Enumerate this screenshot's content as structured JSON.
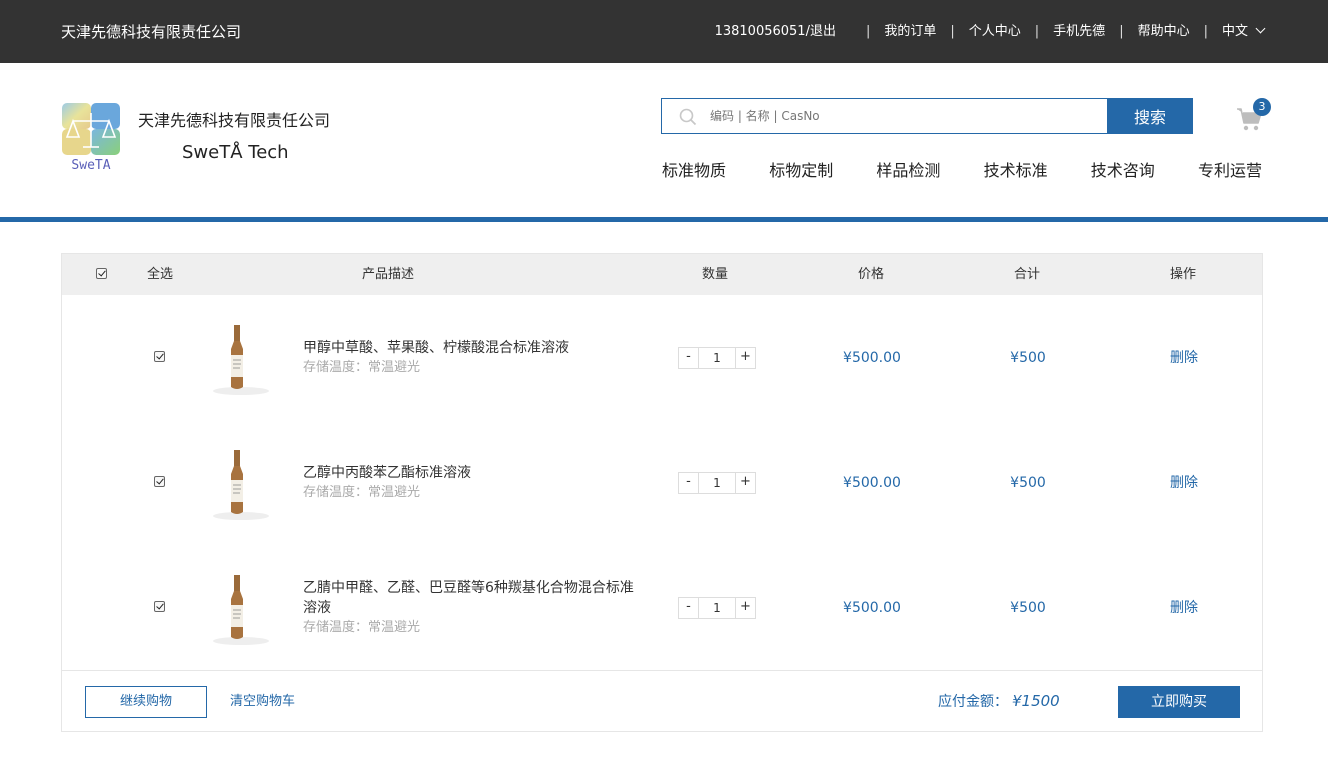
{
  "topbar": {
    "company": "天津先德科技有限责任公司",
    "account": "13810056051/退出",
    "links": [
      "我的订单",
      "个人中心",
      "手机先德",
      "帮助中心"
    ],
    "language": "中文"
  },
  "header": {
    "logo_text": "SweTA",
    "company_cn": "天津先德科技有限责任公司",
    "company_en": "SweTÅ Tech",
    "search_placeholder": "编码 | 名称 | CasNo",
    "search_button": "搜索",
    "cart_count": "3",
    "nav": [
      "标准物质",
      "标物定制",
      "样品检测",
      "技术标准",
      "技术咨询",
      "专利运营"
    ]
  },
  "cart": {
    "columns": {
      "select_all": "全选",
      "description": "产品描述",
      "quantity": "数量",
      "price": "价格",
      "subtotal": "合计",
      "action": "操作"
    },
    "items": [
      {
        "name": "甲醇中草酸、苹果酸、柠檬酸混合标准溶液",
        "storage": "存储温度：常温避光",
        "qty": "1",
        "price": "¥500.00",
        "total": "¥500",
        "action": "删除",
        "checked": true
      },
      {
        "name": "乙醇中丙酸苯乙酯标准溶液",
        "storage": "存储温度：常温避光",
        "qty": "1",
        "price": "¥500.00",
        "total": "¥500",
        "action": "删除",
        "checked": true
      },
      {
        "name": "乙腈中甲醛、乙醛、巴豆醛等6种羰基化合物混合标准溶液",
        "storage": "存储温度：常温避光",
        "qty": "1",
        "price": "¥500.00",
        "total": "¥500",
        "action": "删除",
        "checked": true
      }
    ],
    "qty_minus": "-",
    "qty_plus": "+",
    "footer": {
      "continue": "继续购物",
      "clear": "清空购物车",
      "payable_label": "应付金额：",
      "payable_value": "¥1500",
      "buy": "立即购买"
    }
  },
  "colors": {
    "topbar": "#333333",
    "accent": "#2468a8"
  }
}
